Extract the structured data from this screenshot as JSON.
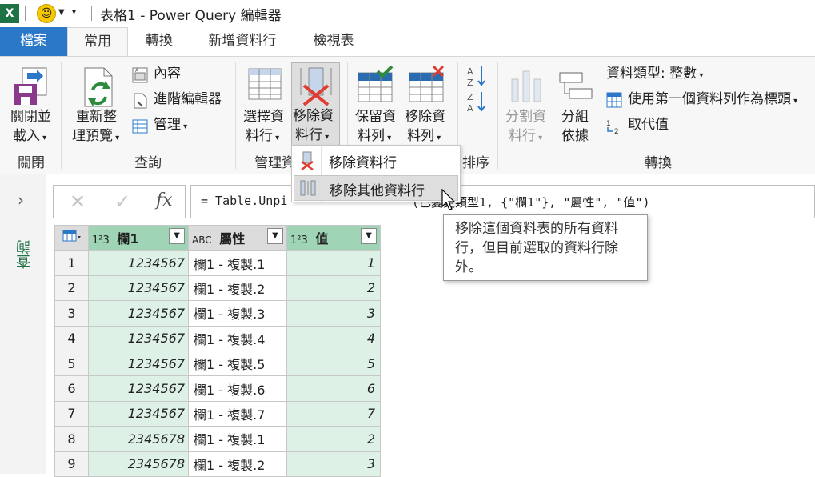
{
  "window": {
    "title": "表格1 - Power Query 編輯器"
  },
  "tabs": [
    {
      "label": "檔案",
      "active": false,
      "file": true
    },
    {
      "label": "常用",
      "active": true
    },
    {
      "label": "轉換"
    },
    {
      "label": "新增資料行"
    },
    {
      "label": "檢視表"
    }
  ],
  "ribbon": {
    "close_load": {
      "line1": "關閉並",
      "line2": "載入"
    },
    "refresh_preview": {
      "line1": "重新整",
      "line2": "理預覽"
    },
    "properties": "內容",
    "advanced_editor": "進階編輯器",
    "manage": "管理",
    "choose_columns": {
      "line1": "選擇資",
      "line2": "料行"
    },
    "remove_columns": {
      "line1": "移除資",
      "line2": "料行"
    },
    "keep_rows": {
      "line1": "保留資",
      "line2": "料列"
    },
    "remove_rows": {
      "line1": "移除資",
      "line2": "料列"
    },
    "split_column": {
      "line1": "分割資",
      "line2": "料行"
    },
    "group_by": {
      "line1": "分組",
      "line2": "依據"
    },
    "data_type": "資料類型: 整數",
    "use_first_row": "使用第一個資料列作為標頭",
    "replace_values": "取代值",
    "groups": {
      "close": "關閉",
      "query": "查詢",
      "manage_columns": "管理資",
      "sort": "排序",
      "transform": "轉換"
    }
  },
  "menu": {
    "items": [
      "移除資料行",
      "移除其他資料行"
    ]
  },
  "tooltip": "移除這個資料表的所有資料行，但目前選取的資料行除外。",
  "left_panel": {
    "label": "查詢"
  },
  "formula": {
    "left": "= Table.Unpi",
    "right": "(已變更類型1, {\"欄1\"}, \"屬性\", \"值\")"
  },
  "columns": [
    {
      "type": "1²3",
      "name": "欄1"
    },
    {
      "type": "ABC",
      "name": "屬性"
    },
    {
      "type": "1²3",
      "name": "值"
    }
  ],
  "rows": [
    {
      "n": "1",
      "c1": "1234567",
      "c2": "欄1 - 複製.1",
      "c3": "1"
    },
    {
      "n": "2",
      "c1": "1234567",
      "c2": "欄1 - 複製.2",
      "c3": "2"
    },
    {
      "n": "3",
      "c1": "1234567",
      "c2": "欄1 - 複製.3",
      "c3": "3"
    },
    {
      "n": "4",
      "c1": "1234567",
      "c2": "欄1 - 複製.4",
      "c3": "4"
    },
    {
      "n": "5",
      "c1": "1234567",
      "c2": "欄1 - 複製.5",
      "c3": "5"
    },
    {
      "n": "6",
      "c1": "1234567",
      "c2": "欄1 - 複製.6",
      "c3": "6"
    },
    {
      "n": "7",
      "c1": "1234567",
      "c2": "欄1 - 複製.7",
      "c3": "7"
    },
    {
      "n": "8",
      "c1": "2345678",
      "c2": "欄1 - 複製.1",
      "c3": "2"
    },
    {
      "n": "9",
      "c1": "2345678",
      "c2": "欄1 - 複製.2",
      "c3": "3"
    }
  ],
  "colors": {
    "file_tab": "#2b78c8",
    "accent_green": "#217346",
    "selected_col": "#ddf1e6",
    "header_sel": "#9fd5b6"
  }
}
